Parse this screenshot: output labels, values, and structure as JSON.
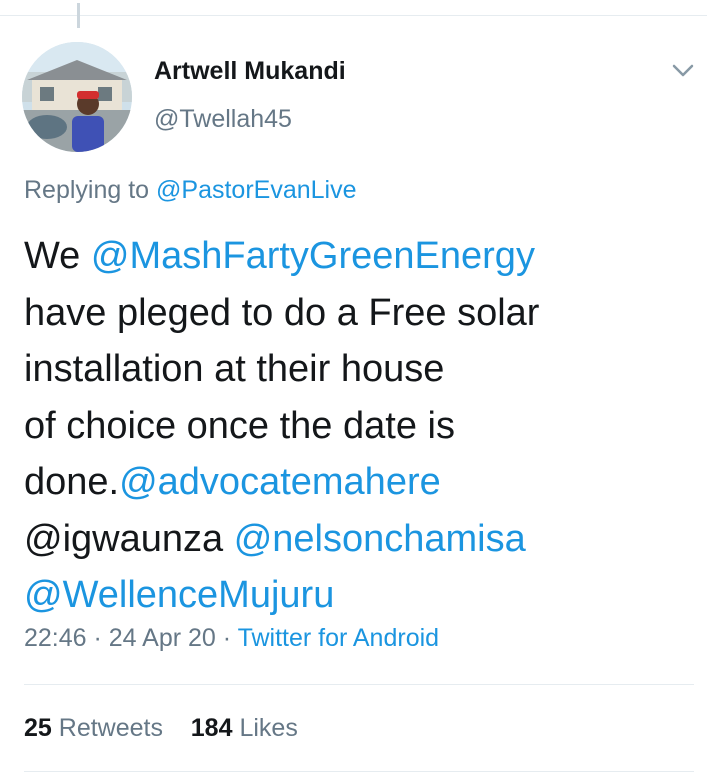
{
  "tweet": {
    "author": {
      "name": "Artwell Mukandi",
      "handle": "@Twellah45",
      "avatar_icon": "user-avatar"
    },
    "replying_prefix": "Replying to",
    "replying_to": "@PastorEvanLive",
    "text": {
      "line1_a": "We ",
      "line1_mention": "@MashFartyGreenEnergy",
      "line2": "have pleged to do a Free solar",
      "line3": "installation at their house",
      "line4": "of choice once the date is",
      "line5_a": "done.",
      "line5_mention": "@advocatemahere",
      "line6_mention_a": "@igwaunza",
      "line6_mention_b": "@nelsonchamisa",
      "line7_mention": "@WellenceMujuru"
    },
    "time": "22:46",
    "date": "24 Apr 20",
    "separator": " · ",
    "source": "Twitter for Android",
    "retweets_count": "25",
    "retweets_label": "Retweets",
    "likes_count": "184",
    "likes_label": "Likes"
  },
  "icons": {
    "menu": "chevron-down-icon"
  },
  "colors": {
    "link": "#1b95e0",
    "secondary_text": "#657786",
    "primary_text": "#14171a",
    "divider": "#e6ecf0"
  }
}
